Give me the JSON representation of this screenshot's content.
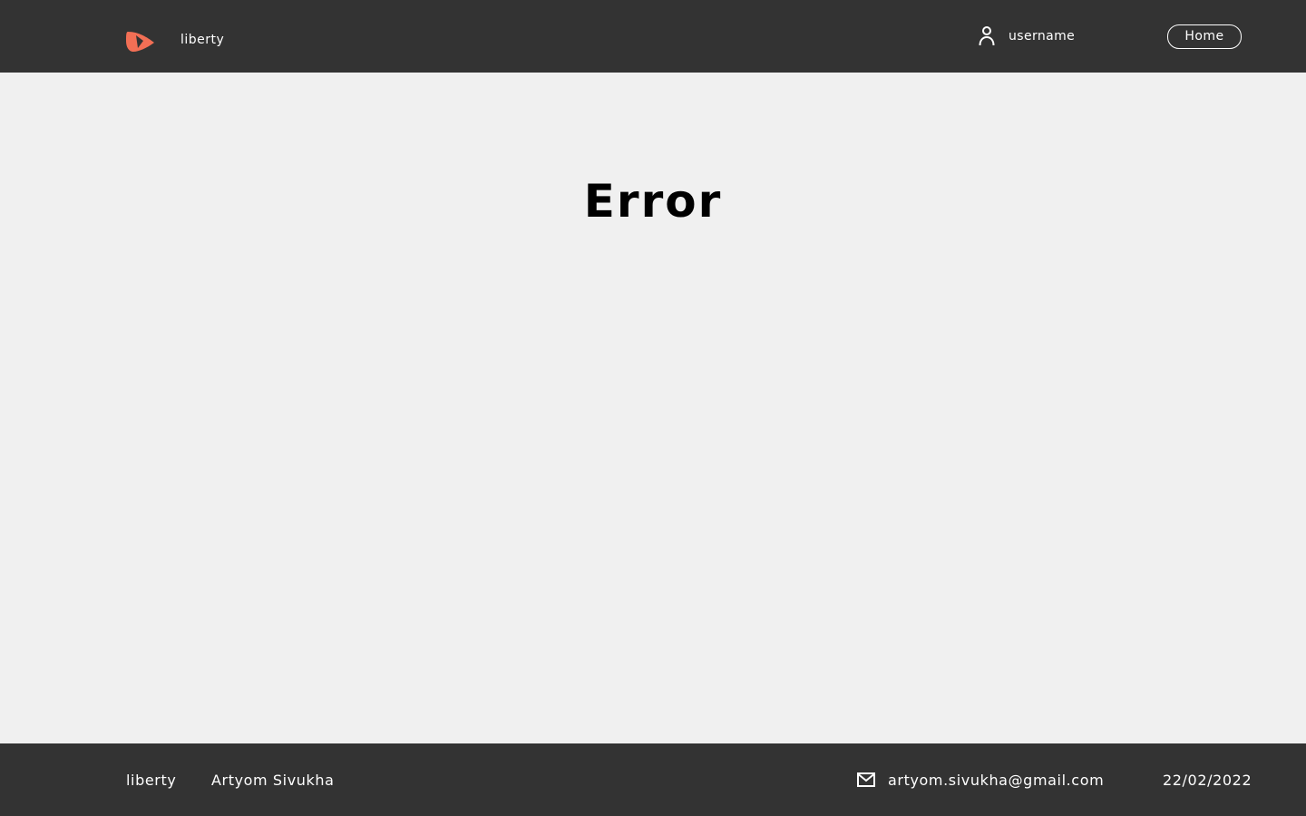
{
  "header": {
    "brand": "liberty",
    "username": "username",
    "home_label": "Home",
    "logo_color": "#f26f55",
    "background": "#333333"
  },
  "main": {
    "title": "Error"
  },
  "footer": {
    "brand": "liberty",
    "author": "Artyom Sivukha",
    "email": "artyom.sivukha@gmail.com",
    "date": "22/02/2022"
  },
  "icons": {
    "logo": "liberty-logo-icon",
    "user": "user-icon",
    "mail": "mail-icon"
  }
}
